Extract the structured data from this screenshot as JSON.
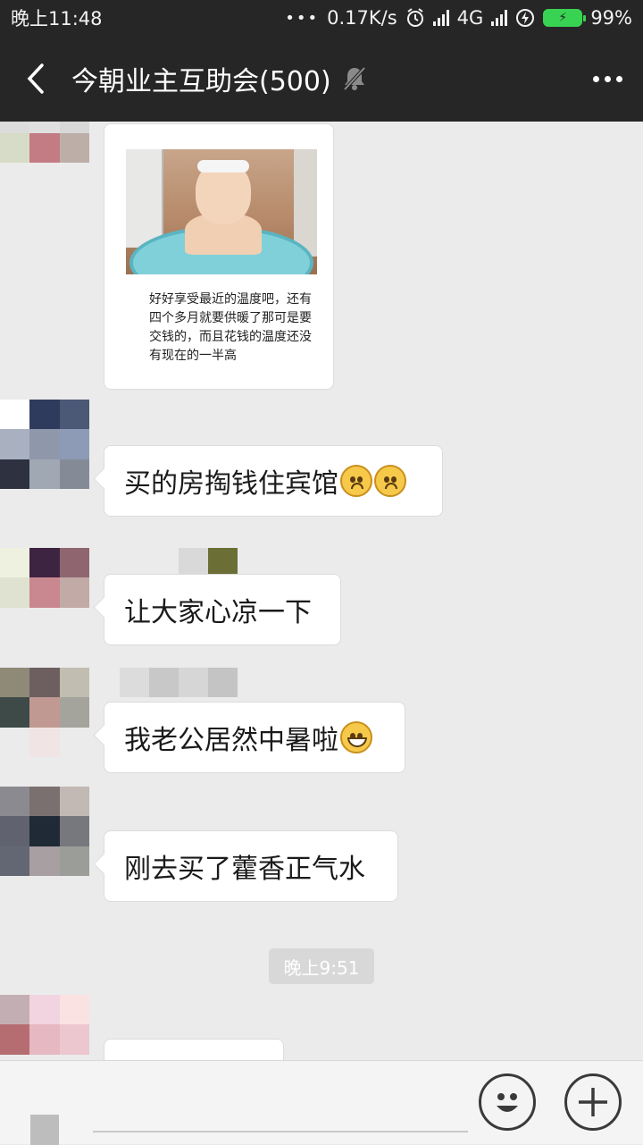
{
  "status_bar": {
    "time": "晚上11:48",
    "dots": "•••",
    "net_speed": "0.17K/s",
    "network": "4G",
    "battery": "99%"
  },
  "header": {
    "title": "今朝业主互助会(500)"
  },
  "messages": {
    "image_caption": "好好享受最近的温度吧，还有四个多月就要供暖了那可是要交钱的，而且花钱的温度还没有现在的一半高",
    "m1": "买的房掏钱住宾馆",
    "m2": "让大家心凉一下",
    "m3": "我老公居然中暑啦",
    "m4": "刚去买了藿香正气水",
    "timestamp": "晚上9:51"
  }
}
